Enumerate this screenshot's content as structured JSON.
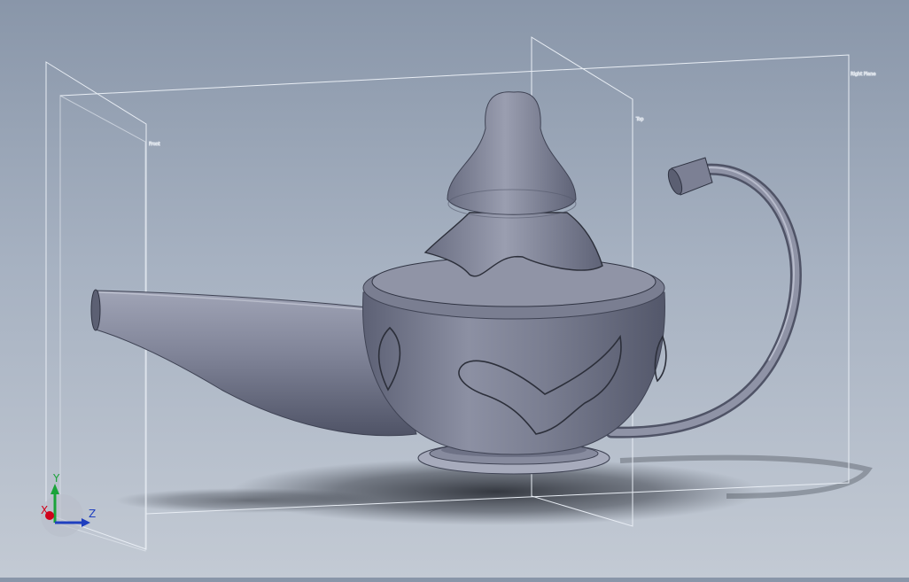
{
  "scene": {
    "planes": {
      "front": "Front",
      "top": "Top",
      "right": "Right Plane"
    },
    "triad": {
      "x": "X",
      "y": "Y",
      "z": "Z"
    },
    "colors": {
      "background_top": "#8996a9",
      "background_bottom": "#c3cad4",
      "model": "#7c8094",
      "model_light": "#a6aabb",
      "model_dark": "#4f5366",
      "axis_x": "#d0021b",
      "axis_y": "#1aa33a",
      "axis_z": "#1f3fbf"
    }
  }
}
